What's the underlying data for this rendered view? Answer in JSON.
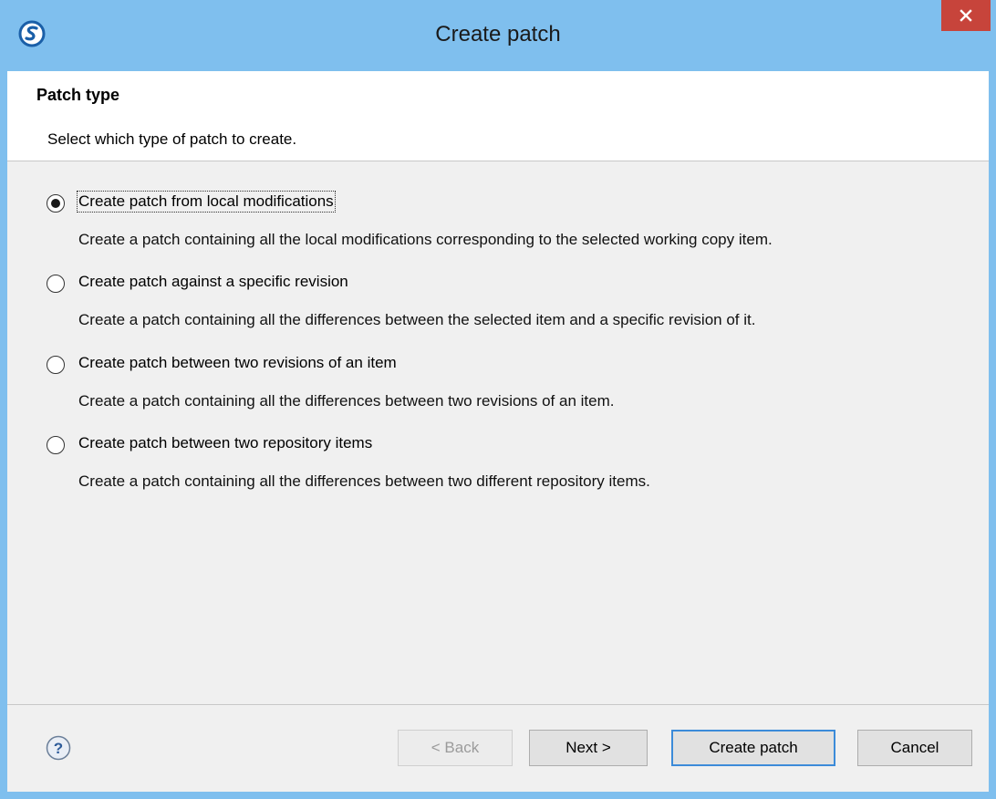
{
  "window": {
    "title": "Create patch",
    "close_label": "×"
  },
  "header": {
    "title": "Patch type",
    "description": "Select which type of patch to create."
  },
  "options": [
    {
      "label": "Create patch from local modifications",
      "description": "Create a patch containing all the local modifications corresponding to the selected working copy item.",
      "selected": true
    },
    {
      "label": "Create patch against a specific revision",
      "description": "Create a patch containing all the differences between the selected item and a specific revision of it.",
      "selected": false
    },
    {
      "label": "Create patch between two revisions of an item",
      "description": "Create a patch containing all the differences between two revisions of an item.",
      "selected": false
    },
    {
      "label": "Create patch between two repository items",
      "description": "Create a patch containing all the differences between two different repository items.",
      "selected": false
    }
  ],
  "buttons": {
    "back": "< Back",
    "next": "Next >",
    "create": "Create patch",
    "cancel": "Cancel"
  },
  "colors": {
    "titlebar": "#7fbfee",
    "close": "#c7443b",
    "client": "#f0f0f0",
    "default_button_border": "#3c8bd9"
  }
}
